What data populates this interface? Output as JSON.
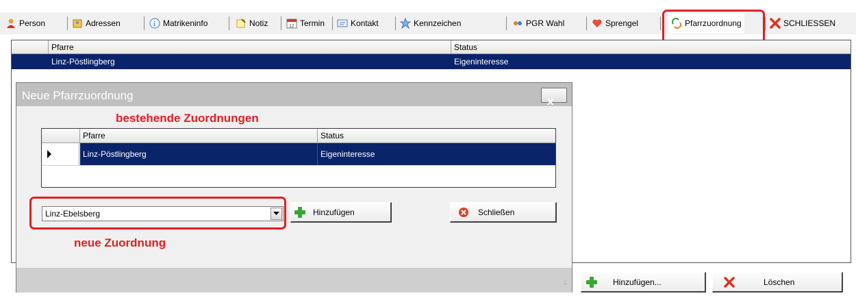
{
  "tabs": [
    {
      "label": "Person",
      "icon": "person-icon"
    },
    {
      "label": "Adressen",
      "icon": "address-book-icon"
    },
    {
      "label": "Matrikeninfo",
      "icon": "info-icon"
    },
    {
      "label": "Notiz",
      "icon": "note-icon"
    },
    {
      "label": "Termin",
      "icon": "calendar-icon"
    },
    {
      "label": "Kontakt",
      "icon": "contact-icon"
    },
    {
      "label": "Kennzeichen",
      "icon": "star-icon"
    },
    {
      "label": "PGR Wahl",
      "icon": "vote-icon"
    },
    {
      "label": "Sprengel",
      "icon": "heart-icon"
    },
    {
      "label": "Pfarrzuordnung",
      "icon": "assign-icon",
      "selected": true
    },
    {
      "label": "SCHLIESSEN",
      "icon": "close-red-icon"
    }
  ],
  "main_grid": {
    "columns": [
      "Pfarre",
      "Status"
    ],
    "rows": [
      [
        "Linz-Pöstlingberg",
        "Eigeninteresse"
      ]
    ]
  },
  "dialog": {
    "title": "Neue Pfarrzuordnung",
    "close_label": "x",
    "annotation_existing": "bestehende Zuordnungen",
    "annotation_new": "neue Zuordnung",
    "grid": {
      "columns": [
        "Pfarre",
        "Status"
      ],
      "rows": [
        [
          "Linz-Pöstlingberg",
          "Eigeninteresse"
        ]
      ]
    },
    "combo_value": "Linz-Ebelsberg",
    "add_label": "Hinzufügen",
    "close_button_label": "Schließen"
  },
  "bottom_buttons": {
    "add_label": "Hinzufügen...",
    "delete_label": "Löschen"
  },
  "colors": {
    "selection": "#0a246a",
    "annotation_red": "#e31e24",
    "add_green": "#3aa535"
  }
}
